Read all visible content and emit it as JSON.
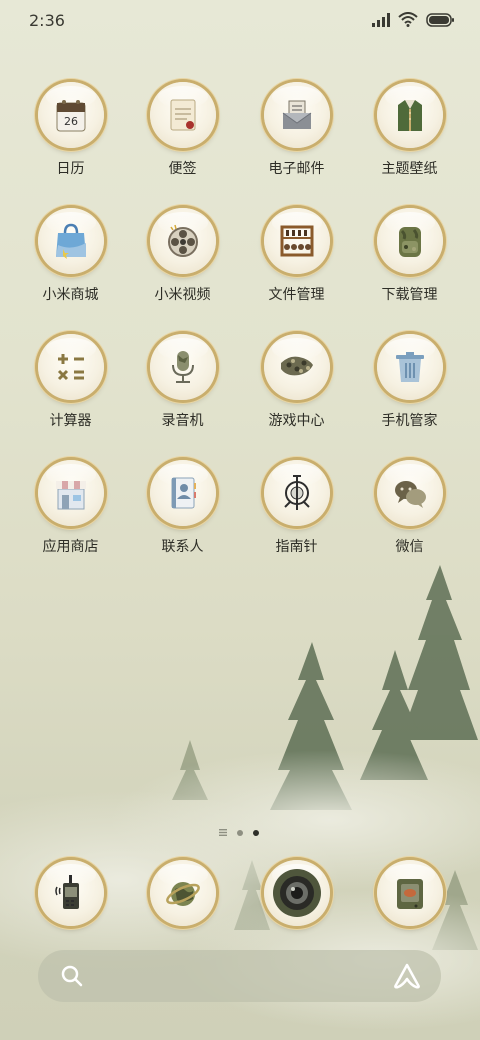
{
  "status_bar": {
    "time": "2:36",
    "icons": [
      "signal-icon",
      "wifi-icon",
      "battery-icon"
    ]
  },
  "apps": [
    {
      "label": "日历",
      "icon": "calendar-icon",
      "date": "26"
    },
    {
      "label": "便签",
      "icon": "notes-icon"
    },
    {
      "label": "电子邮件",
      "icon": "email-icon"
    },
    {
      "label": "主题壁纸",
      "icon": "themes-icon"
    },
    {
      "label": "小米商城",
      "icon": "shopping-bag-icon"
    },
    {
      "label": "小米视频",
      "icon": "film-reel-icon"
    },
    {
      "label": "文件管理",
      "icon": "abacus-icon"
    },
    {
      "label": "下载管理",
      "icon": "backpack-icon"
    },
    {
      "label": "计算器",
      "icon": "calculator-icon"
    },
    {
      "label": "录音机",
      "icon": "microphone-icon"
    },
    {
      "label": "游戏中心",
      "icon": "puzzle-icon"
    },
    {
      "label": "手机管家",
      "icon": "trash-bin-icon"
    },
    {
      "label": "应用商店",
      "icon": "store-icon"
    },
    {
      "label": "联系人",
      "icon": "contacts-book-icon"
    },
    {
      "label": "指南针",
      "icon": "compass-emblem-icon"
    },
    {
      "label": "微信",
      "icon": "chat-bubbles-icon"
    }
  ],
  "dock": [
    {
      "icon": "walkie-talkie-icon"
    },
    {
      "icon": "browser-globe-icon"
    },
    {
      "icon": "camera-lens-icon"
    },
    {
      "icon": "gallery-radio-icon"
    }
  ],
  "page_indicator": {
    "pages": 3,
    "active": 2
  },
  "search": {
    "icon": "search-icon",
    "assistant": "assistant-icon"
  },
  "colors": {
    "accent_gold": "#c9ae6d",
    "camo_green": "#6b7545",
    "text": "#2e2e27"
  }
}
